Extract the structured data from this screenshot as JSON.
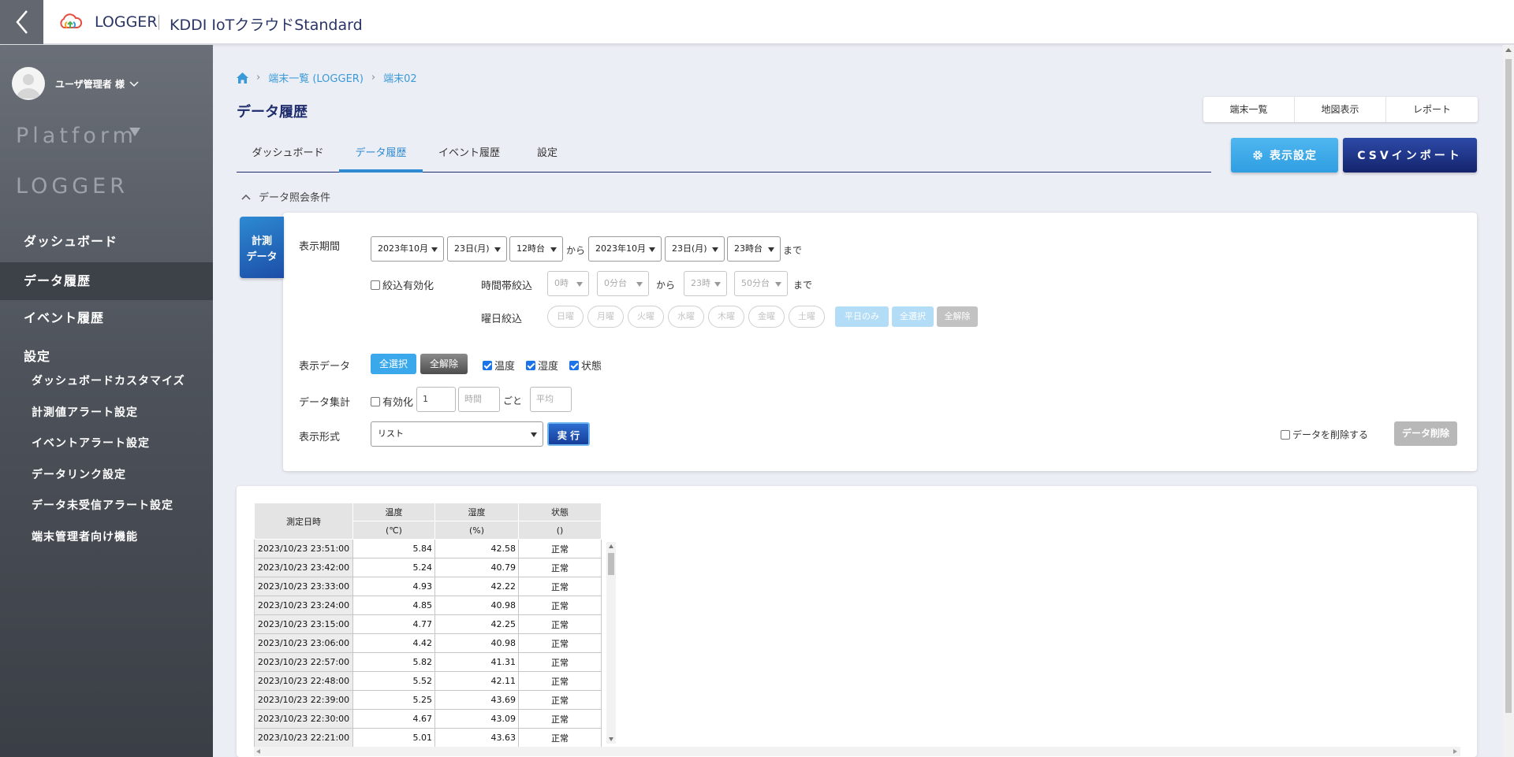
{
  "header": {
    "app_title": "LOGGER",
    "service_title": "KDDI IoTクラウドStandard"
  },
  "sidebar": {
    "user_name": "ユーザ管理者 様",
    "platform_label": "Platform",
    "logger_label": "LOGGER",
    "nav": [
      {
        "label": "ダッシュボード",
        "active": false
      },
      {
        "label": "データ履歴",
        "active": true
      },
      {
        "label": "イベント履歴",
        "active": false
      },
      {
        "label": "設定",
        "active": false
      }
    ],
    "sub_items": [
      "ダッシュボードカスタマイズ",
      "計測値アラート設定",
      "イベントアラート設定",
      "データリンク設定",
      "データ未受信アラート設定",
      "端末管理者向け機能"
    ]
  },
  "breadcrumb": {
    "items": [
      "端末一覧 (LOGGER)",
      "端末02"
    ]
  },
  "page": {
    "title": "データ履歴"
  },
  "top_buttons": [
    "端末一覧",
    "地図表示",
    "レポート"
  ],
  "tabs": [
    {
      "label": "ダッシュボード",
      "active": false
    },
    {
      "label": "データ履歴",
      "active": true
    },
    {
      "label": "イベント履歴",
      "active": false
    },
    {
      "label": "設定",
      "active": false
    }
  ],
  "actions": {
    "display_settings": "表示設定",
    "csv_import": "CSVインポート"
  },
  "conditions": {
    "toggle_label": "データ照会条件",
    "side_tab": [
      "計測",
      "データ"
    ],
    "period_label": "表示期間",
    "from": {
      "month": "2023年10月",
      "day": "23日(月)",
      "hour": "12時台"
    },
    "kara": "から",
    "to": {
      "month": "2023年10月",
      "day": "23日(月)",
      "hour": "23時台"
    },
    "made": "まで",
    "filter_enable": "絞込有効化",
    "time_filter_label": "時間帯絞込",
    "time_from_h": "0時",
    "time_from_m": "0分台",
    "time_to_h": "23時",
    "time_to_m": "50分台",
    "weekday_label": "曜日絞込",
    "weekdays": [
      "日曜",
      "月曜",
      "火曜",
      "水曜",
      "木曜",
      "金曜",
      "土曜"
    ],
    "weekday_only": "平日のみ",
    "select_all": "全選択",
    "deselect_all": "全解除",
    "display_data_label": "表示データ",
    "display_select_all": "全選択",
    "display_deselect_all": "全解除",
    "data_checks": [
      {
        "label": "温度",
        "checked": true
      },
      {
        "label": "湿度",
        "checked": true
      },
      {
        "label": "状態",
        "checked": true
      }
    ],
    "aggregate_label": "データ集計",
    "aggregate_enable": "有効化",
    "aggregate_value": "1",
    "aggregate_unit_placeholder": "時間",
    "aggregate_per": "ごと",
    "aggregate_method_placeholder": "平均",
    "format_label": "表示形式",
    "format_value": "リスト",
    "execute": "実 行",
    "delete_check": "データを削除する",
    "delete_button": "データ削除"
  },
  "table": {
    "headers": [
      "測定日時",
      "温度",
      "湿度",
      "状態"
    ],
    "units": [
      "(℃)",
      "(%)",
      "()"
    ],
    "rows": [
      [
        "2023/10/23 23:51:00",
        "5.84",
        "42.58",
        "正常"
      ],
      [
        "2023/10/23 23:42:00",
        "5.24",
        "40.79",
        "正常"
      ],
      [
        "2023/10/23 23:33:00",
        "4.93",
        "42.22",
        "正常"
      ],
      [
        "2023/10/23 23:24:00",
        "4.85",
        "40.98",
        "正常"
      ],
      [
        "2023/10/23 23:15:00",
        "4.77",
        "42.25",
        "正常"
      ],
      [
        "2023/10/23 23:06:00",
        "4.42",
        "40.98",
        "正常"
      ],
      [
        "2023/10/23 22:57:00",
        "5.82",
        "41.31",
        "正常"
      ],
      [
        "2023/10/23 22:48:00",
        "5.52",
        "42.11",
        "正常"
      ],
      [
        "2023/10/23 22:39:00",
        "5.25",
        "43.69",
        "正常"
      ],
      [
        "2023/10/23 22:30:00",
        "4.67",
        "43.09",
        "正常"
      ],
      [
        "2023/10/23 22:21:00",
        "5.01",
        "43.63",
        "正常"
      ]
    ]
  },
  "colors": {
    "accent": "#2d8ad2",
    "navy": "#1f2d6e",
    "sidebar": "#4e535b"
  }
}
